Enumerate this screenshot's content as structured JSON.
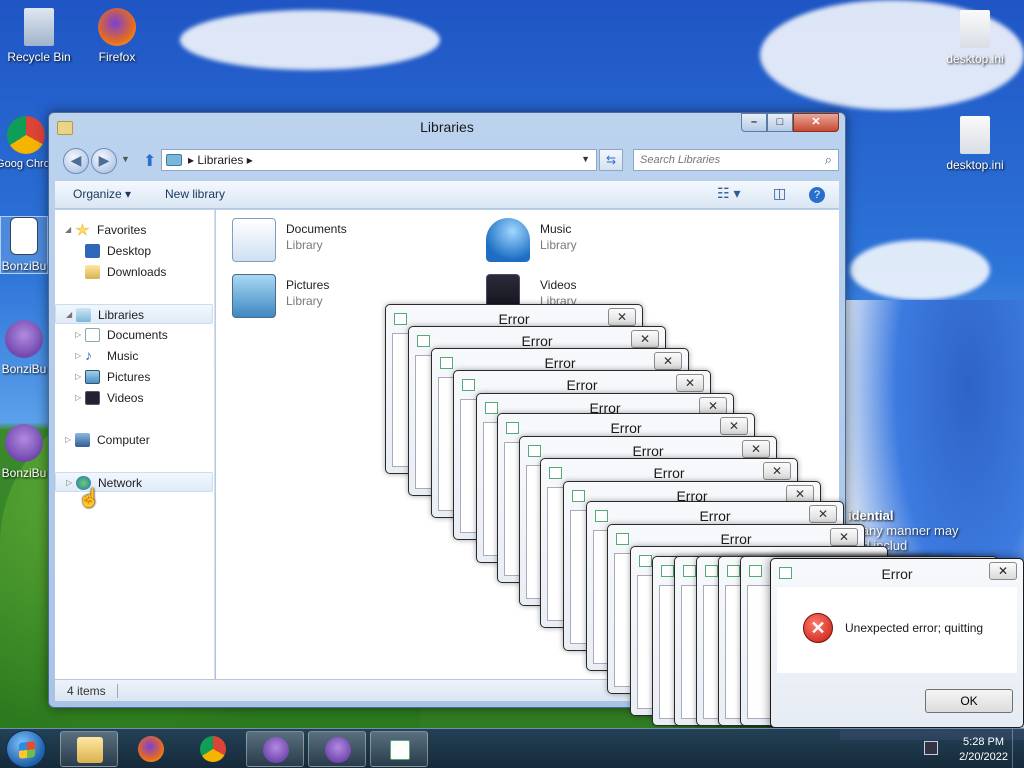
{
  "desktop": {
    "icons": [
      {
        "label": "Recycle Bin"
      },
      {
        "label": "Firefox"
      },
      {
        "label": "Goog Chron"
      },
      {
        "label": "BonziBu"
      },
      {
        "label": "BonziBu"
      },
      {
        "label": "BonziBu"
      },
      {
        "label": "desktop.ini"
      },
      {
        "label": "desktop.ini"
      }
    ],
    "wallpaper_text": {
      "heading": "idential",
      "line1": "in any manner may",
      "line2": "and includ"
    }
  },
  "explorer": {
    "title": "Libraries",
    "caption": {
      "minimize": "–",
      "maximize": "□",
      "close": "✕"
    },
    "address": {
      "crumb": "Libraries",
      "separator": "▸"
    },
    "search": {
      "placeholder": "Search Libraries"
    },
    "toolbar": {
      "organize": "Organize ▾",
      "new_library": "New library",
      "help": "?"
    },
    "nav": {
      "favorites": "Favorites",
      "desktop": "Desktop",
      "downloads": "Downloads",
      "libraries": "Libraries",
      "documents": "Documents",
      "music": "Music",
      "pictures": "Pictures",
      "videos": "Videos",
      "computer": "Computer",
      "network": "Network"
    },
    "libraries": [
      {
        "name": "Documents",
        "sub": "Library"
      },
      {
        "name": "Music",
        "sub": "Library"
      },
      {
        "name": "Pictures",
        "sub": "Library"
      },
      {
        "name": "Videos",
        "sub": "Library"
      }
    ],
    "status": "4 items"
  },
  "error_cascade": {
    "title": "Error",
    "close": "✕"
  },
  "error_dialog": {
    "title": "Error",
    "close": "✕",
    "message": "Unexpected error; quitting",
    "ok": "OK",
    "icon_glyph": "✕"
  },
  "taskbar": {
    "time": "5:28 PM",
    "date": "2/20/2022"
  },
  "colors": {
    "accent": "#2a6fcc",
    "error_red": "#c41b12"
  }
}
